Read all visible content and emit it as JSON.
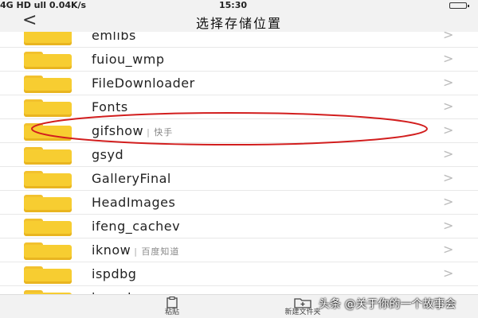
{
  "status": {
    "left": "4G HD ull 0.04K/s",
    "time": "15:30"
  },
  "header": {
    "title": "选择存储位置",
    "back_glyph": "<"
  },
  "folders": [
    {
      "name": "emlibs",
      "alias": ""
    },
    {
      "name": "fuiou_wmp",
      "alias": ""
    },
    {
      "name": "FileDownloader",
      "alias": ""
    },
    {
      "name": "Fonts",
      "alias": ""
    },
    {
      "name": "gifshow",
      "alias": "快手"
    },
    {
      "name": "gsyd",
      "alias": ""
    },
    {
      "name": "GalleryFinal",
      "alias": ""
    },
    {
      "name": "HeadImages",
      "alias": ""
    },
    {
      "name": "ifeng_cachev",
      "alias": ""
    },
    {
      "name": "iknow",
      "alias": "百度知道"
    },
    {
      "name": "ispdbg",
      "alias": ""
    },
    {
      "name": "ispeak",
      "alias": ""
    }
  ],
  "chevron_glyph": ">",
  "toolbar": {
    "paste_label": "粘贴",
    "new_folder_label": "新建文件夹"
  },
  "watermark": "头条 @关于你的一个故事会",
  "colors": {
    "folder": "#f7cd31",
    "annotation": "#d21e1e",
    "bar_bg": "#f2f2f2"
  },
  "icons": {
    "paste": "clipboard-icon",
    "new_folder": "folder-plus-icon"
  }
}
